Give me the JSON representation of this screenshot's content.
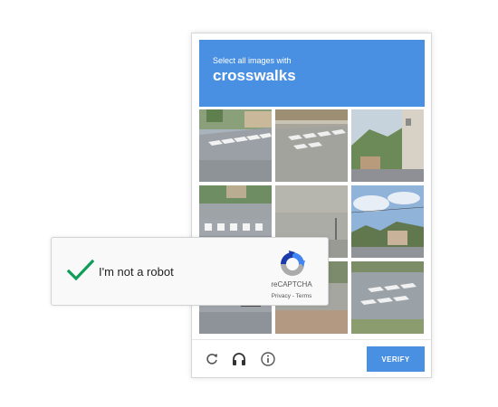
{
  "challenge": {
    "instruction": "Select all images with",
    "target": "crosswalks",
    "tiles": [
      {
        "label": "tile-1"
      },
      {
        "label": "tile-2"
      },
      {
        "label": "tile-3"
      },
      {
        "label": "tile-4"
      },
      {
        "label": "tile-5"
      },
      {
        "label": "tile-6"
      },
      {
        "label": "tile-7"
      },
      {
        "label": "tile-8"
      },
      {
        "label": "tile-9"
      }
    ],
    "footer": {
      "reload_icon": "reload-icon",
      "audio_icon": "headphones-icon",
      "info_icon": "info-icon",
      "verify_label": "VERIFY"
    }
  },
  "anchor": {
    "label": "I'm not a robot",
    "checked": true,
    "brand": "reCAPTCHA",
    "privacy": "Privacy",
    "separator": " - ",
    "terms": "Terms"
  },
  "colors": {
    "accent": "#4a90e2",
    "check": "#0f9d58",
    "logo_blue": "#1c3aa9",
    "logo_light": "#4285f4",
    "logo_gray": "#ababab"
  }
}
